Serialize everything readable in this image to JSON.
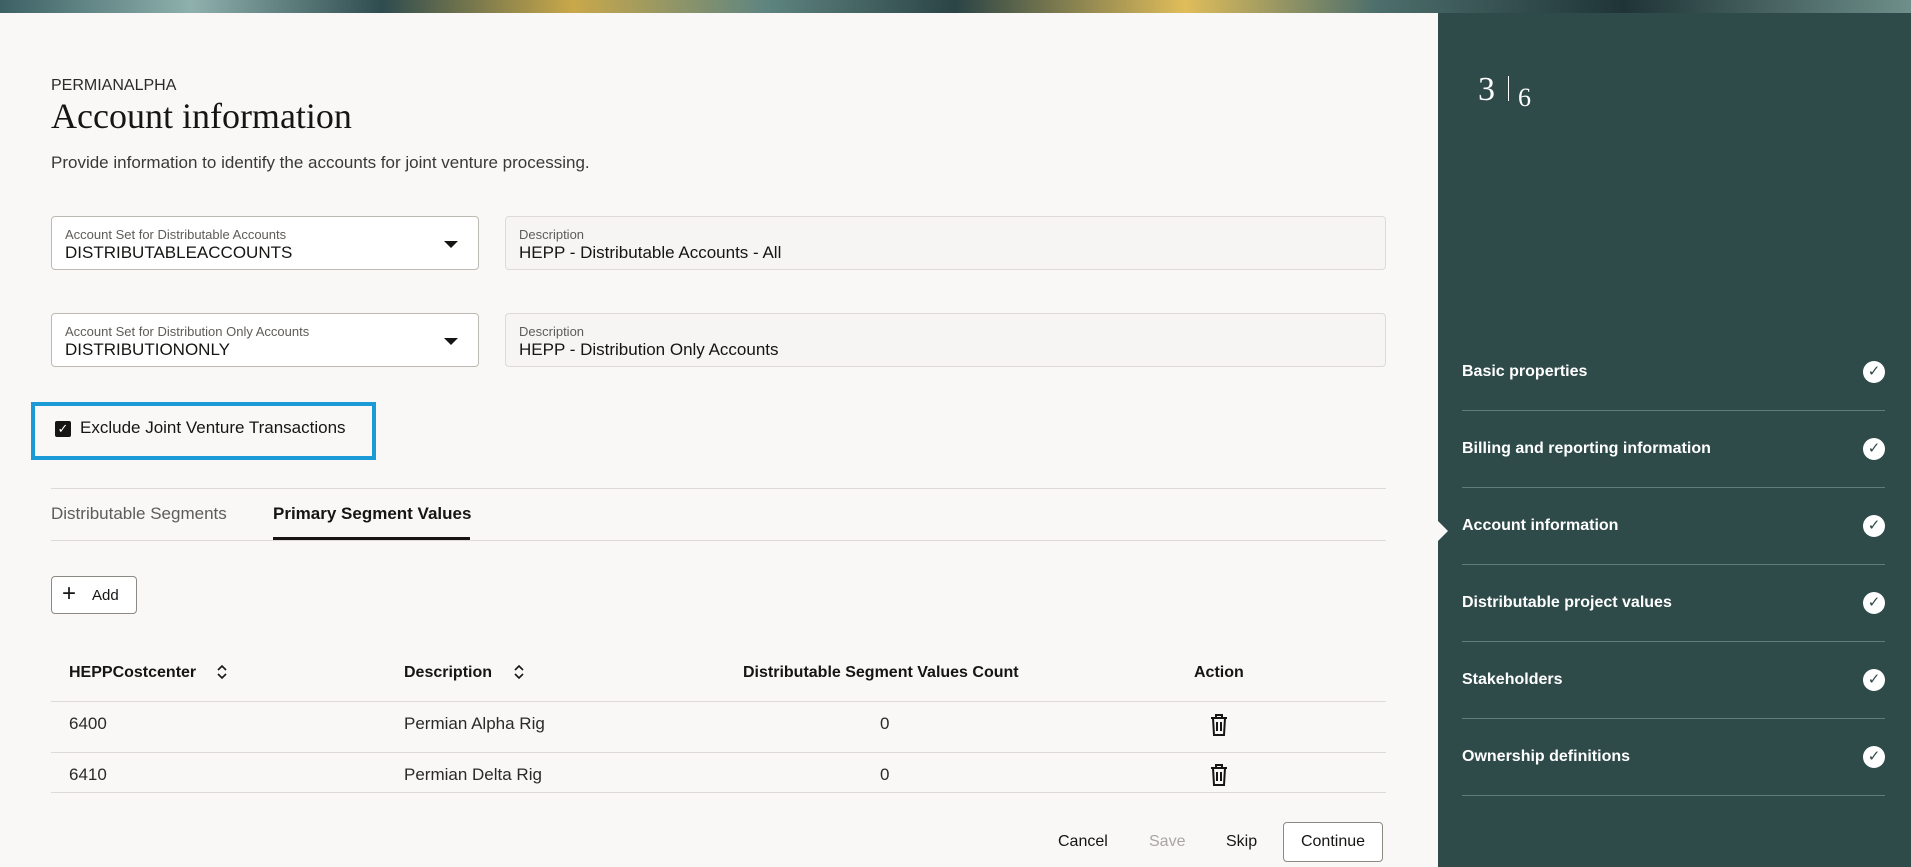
{
  "header": {
    "org": "PERMIANALPHA",
    "title": "Account information",
    "subtitle": "Provide information to identify the accounts for joint venture processing."
  },
  "fields": {
    "distributable_set": {
      "label": "Account Set for Distributable Accounts",
      "value": "DISTRIBUTABLEACCOUNTS"
    },
    "distributable_desc": {
      "label": "Description",
      "value": "HEPP - Distributable Accounts - All"
    },
    "distribution_only_set": {
      "label": "Account Set for Distribution Only Accounts",
      "value": "DISTRIBUTIONONLY"
    },
    "distribution_only_desc": {
      "label": "Description",
      "value": "HEPP - Distribution Only Accounts"
    }
  },
  "exclude_checkbox": {
    "label": "Exclude Joint Venture Transactions",
    "checked": true
  },
  "tabs": [
    {
      "label": "Distributable Segments",
      "active": false
    },
    {
      "label": "Primary Segment Values",
      "active": true
    }
  ],
  "add_button": {
    "label": "Add"
  },
  "table": {
    "columns": [
      "HEPPCostcenter",
      "Description",
      "Distributable Segment Values Count",
      "Action"
    ],
    "rows": [
      {
        "costcenter": "6400",
        "description": "Permian Alpha Rig",
        "count": "0"
      },
      {
        "costcenter": "6410",
        "description": "Permian Delta Rig",
        "count": "0"
      }
    ]
  },
  "footer": {
    "cancel": "Cancel",
    "save": "Save",
    "skip": "Skip",
    "continue": "Continue"
  },
  "progress": {
    "current": "3",
    "total": "6",
    "steps": [
      {
        "label": "Basic properties",
        "complete": true
      },
      {
        "label": "Billing and reporting information",
        "complete": true
      },
      {
        "label": "Account information",
        "complete": true
      },
      {
        "label": "Distributable project values",
        "complete": true
      },
      {
        "label": "Stakeholders",
        "complete": true
      },
      {
        "label": "Ownership definitions",
        "complete": true
      }
    ]
  },
  "icons": {
    "caret": "chevron-down-icon",
    "check": "checkmark-icon",
    "sort": "sort-icon",
    "delete": "trash-icon",
    "add": "plus-icon"
  },
  "colors": {
    "panel": "#2e4b4a",
    "highlight": "#1a9ad6",
    "background": "#f9f8f6"
  }
}
